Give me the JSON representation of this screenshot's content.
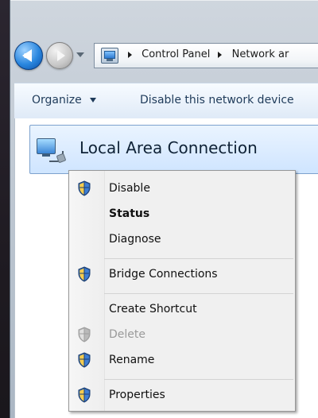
{
  "breadcrumbs": [
    {
      "label": "Control Panel"
    },
    {
      "label": "Network ar"
    }
  ],
  "toolbar": {
    "organize_label": "Organize",
    "disable_device_label": "Disable this network device"
  },
  "selected_connection": {
    "title": "Local Area Connection"
  },
  "context_menu": {
    "items": [
      {
        "label": "Disable",
        "shield": true,
        "enabled": true,
        "bold": false
      },
      {
        "label": "Status",
        "shield": false,
        "enabled": true,
        "bold": true
      },
      {
        "label": "Diagnose",
        "shield": false,
        "enabled": true,
        "bold": false
      },
      {
        "label": "Bridge Connections",
        "shield": true,
        "enabled": true,
        "bold": false
      },
      {
        "label": "Create Shortcut",
        "shield": false,
        "enabled": true,
        "bold": false
      },
      {
        "label": "Delete",
        "shield": true,
        "enabled": false,
        "bold": false
      },
      {
        "label": "Rename",
        "shield": true,
        "enabled": true,
        "bold": false
      },
      {
        "label": "Properties",
        "shield": true,
        "enabled": true,
        "bold": false
      }
    ]
  },
  "icons": {
    "back": "back-arrow-icon",
    "forward": "forward-arrow-icon",
    "network_connections": "network-connections-icon",
    "shield": "uac-shield-icon"
  }
}
